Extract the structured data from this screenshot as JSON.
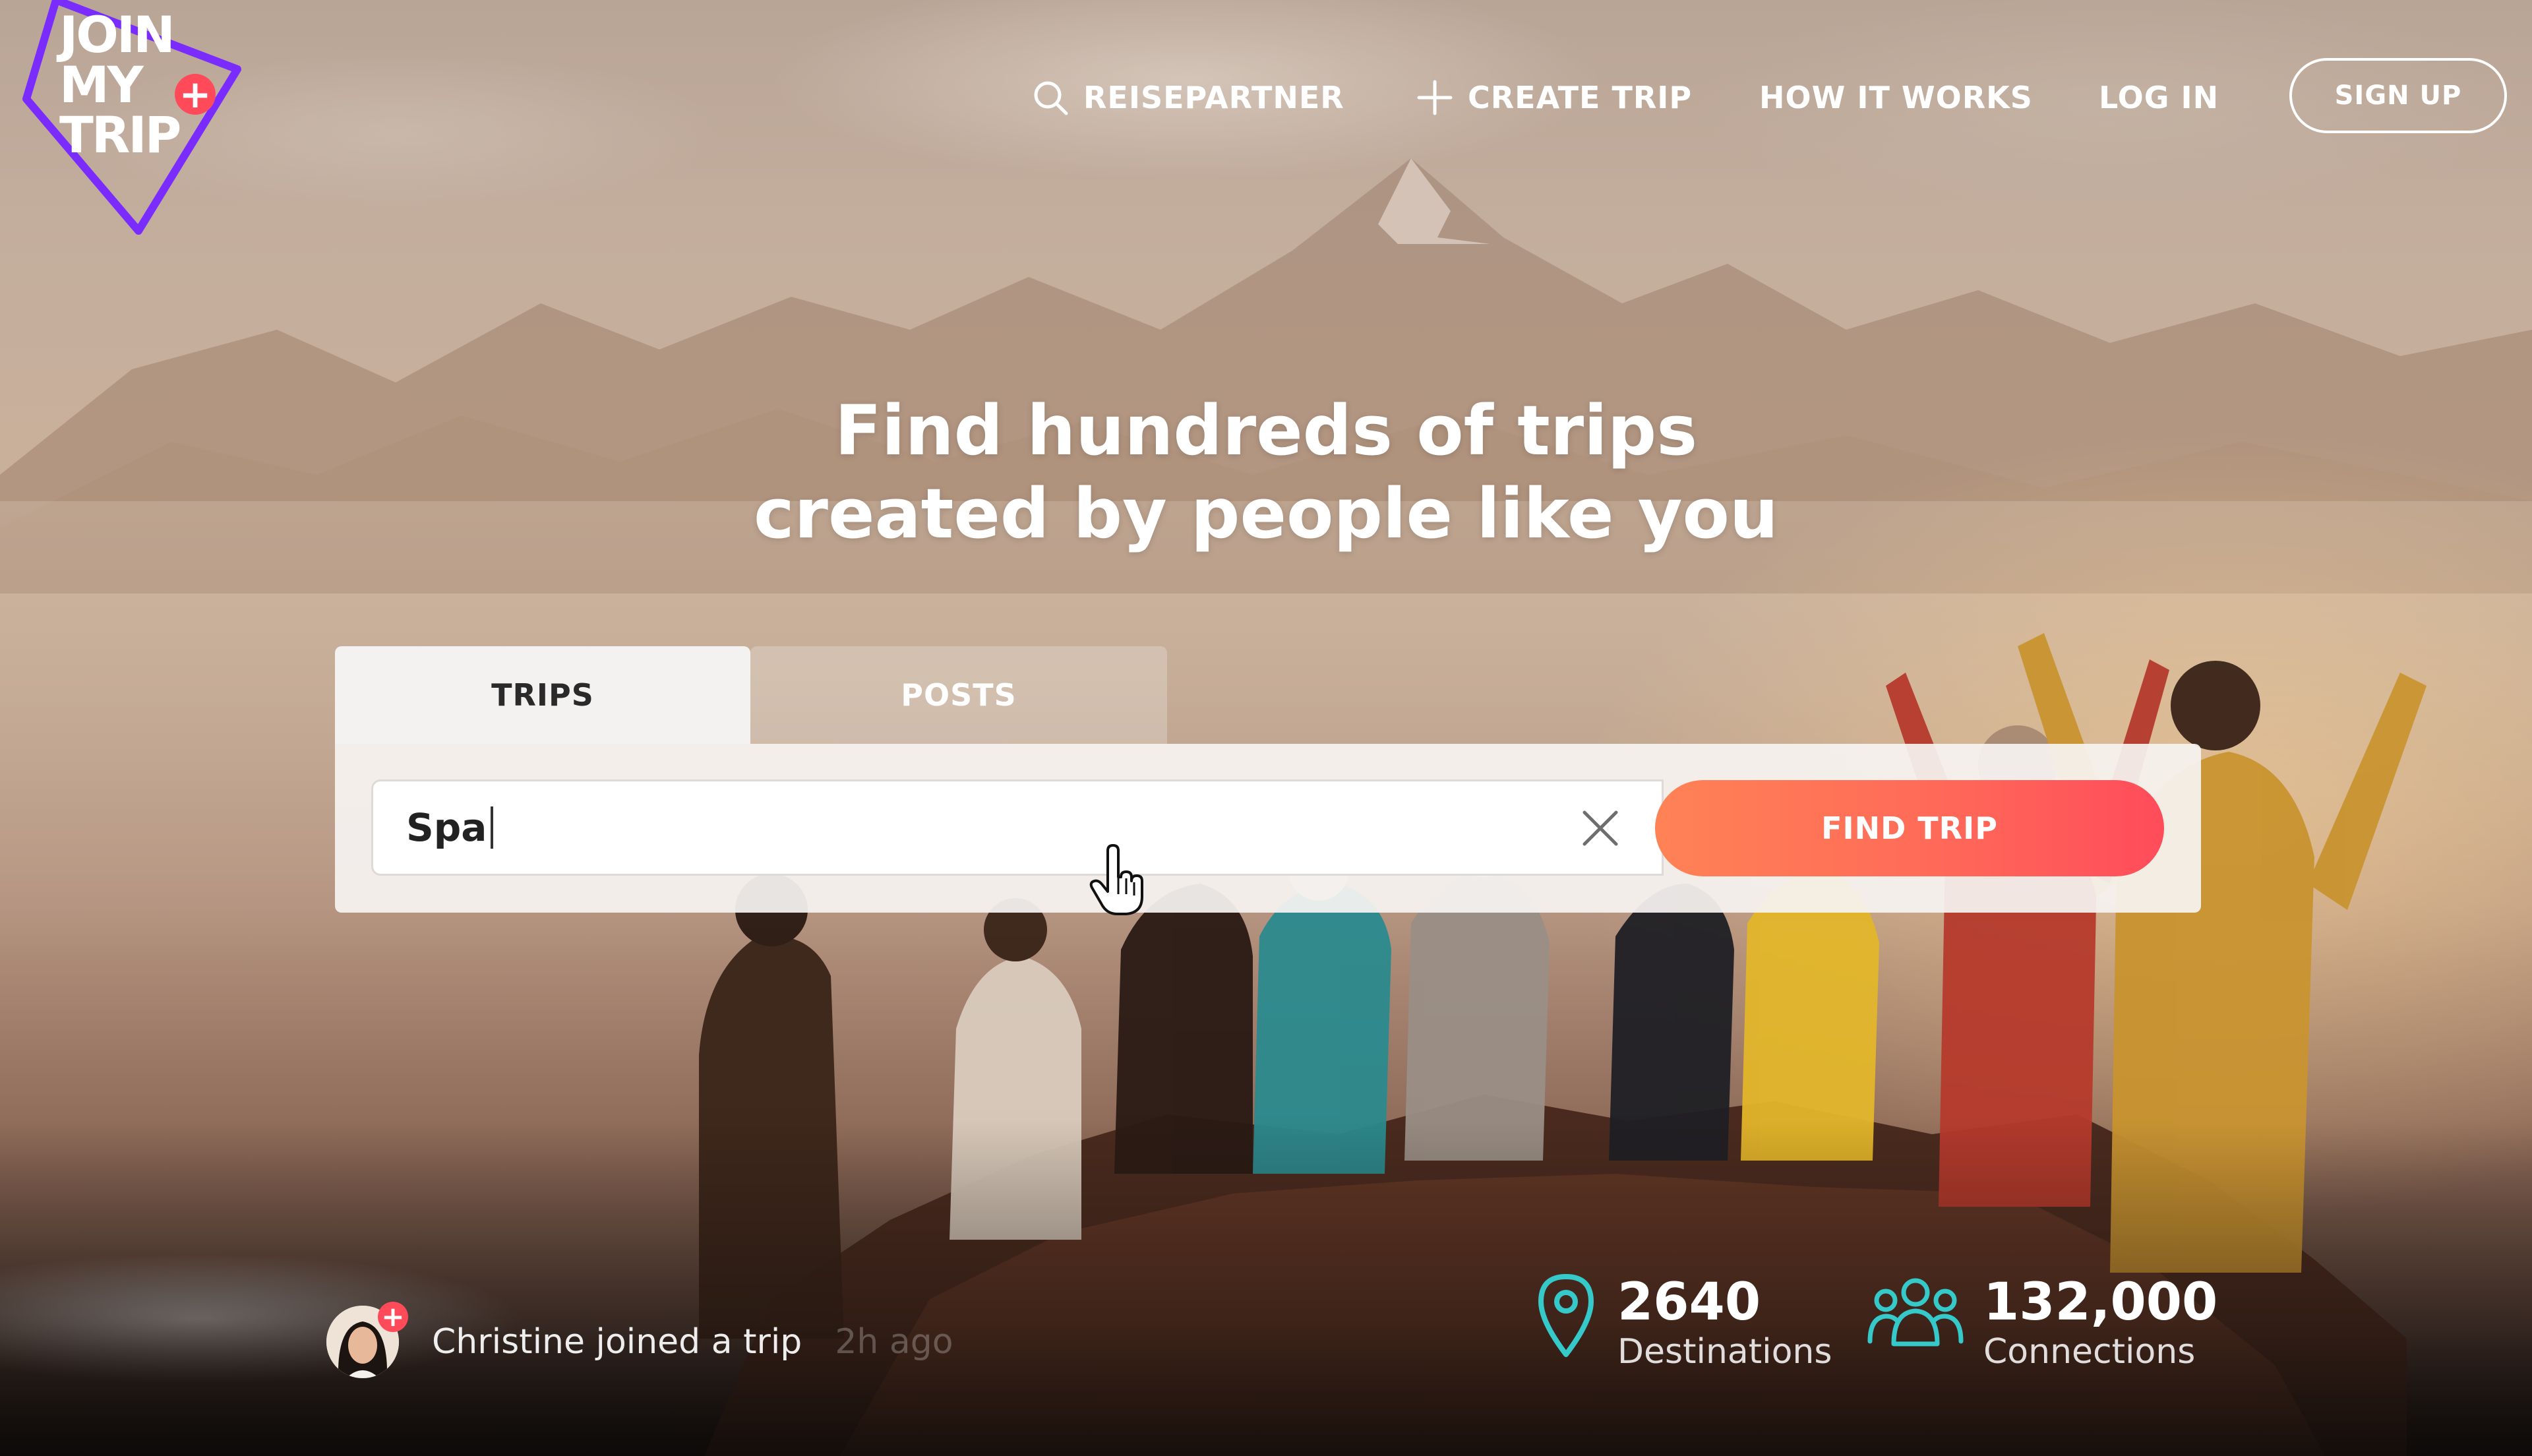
{
  "brand": {
    "logo_lines": [
      "JOIN",
      "MY",
      "TRIP"
    ],
    "logo_plus": "+"
  },
  "nav": {
    "search_label": "REISEPARTNER",
    "create_label": "CREATE TRIP",
    "how_label": "HOW IT WORKS",
    "login_label": "LOG IN",
    "signup_label": "SIGN UP"
  },
  "hero": {
    "line1": "Find hundreds of trips",
    "line2": "created by people like you"
  },
  "search": {
    "tabs": [
      {
        "label": "TRIPS",
        "active": true
      },
      {
        "label": "POSTS",
        "active": false
      }
    ],
    "value": "Spa",
    "button_label": "FIND TRIP"
  },
  "activity": {
    "text": "Christine joined a trip",
    "time": "2h ago"
  },
  "stats": [
    {
      "value": "2640",
      "label": "Destinations",
      "icon": "map-pin-icon"
    },
    {
      "value": "132,000",
      "label": "Connections",
      "icon": "users-icon"
    }
  ],
  "colors": {
    "accent_gradient_start": "#ff8256",
    "accent_gradient_end": "#ff4c5b",
    "logo_purple": "#7a2cff",
    "stat_icon_teal": "#35c9c9",
    "badge_red": "#ff4a5a"
  }
}
